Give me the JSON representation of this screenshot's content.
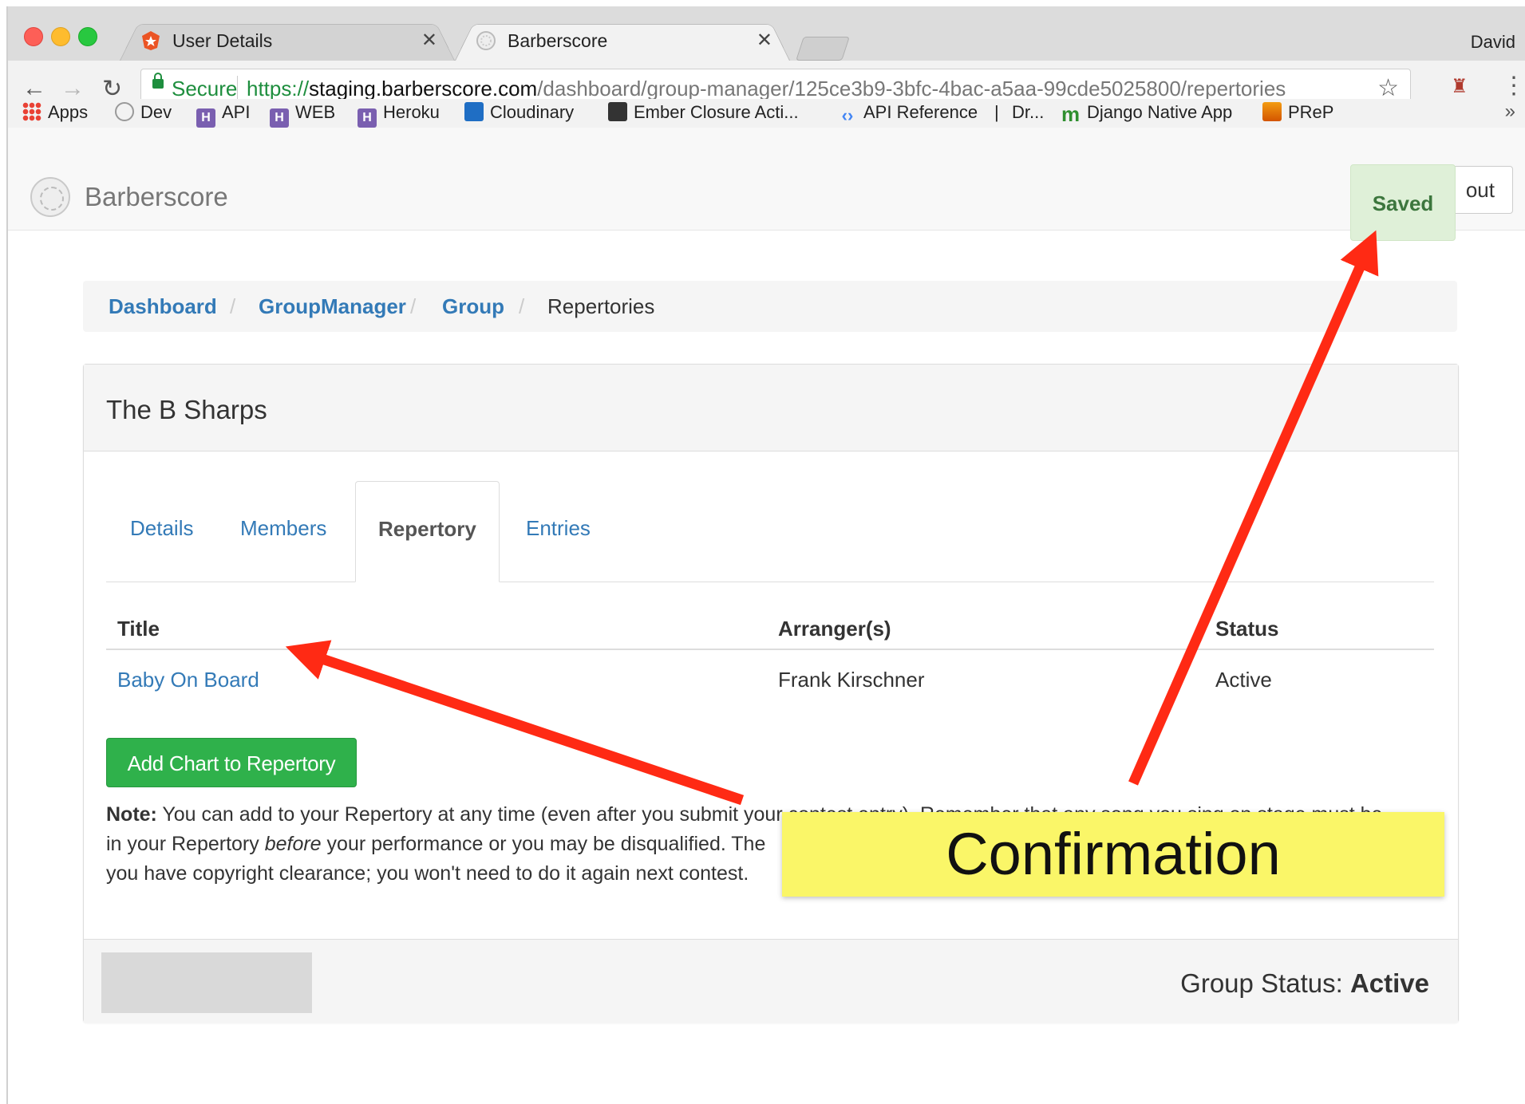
{
  "browser": {
    "tabs": [
      {
        "title": "User Details",
        "active": false
      },
      {
        "title": "Barberscore",
        "active": true
      }
    ],
    "profile_name": "David",
    "address": {
      "secure_label": "Secure",
      "url_scheme": "https://",
      "url_host": "staging.barberscore.com",
      "url_path": "/dashboard/group-manager/125ce3b9-3bfc-4bac-a5aa-99cde5025800/repertories"
    },
    "bookmarks": [
      {
        "label": "Apps",
        "icon": "apps-grid-icon"
      },
      {
        "label": "Dev",
        "icon": "globe-icon"
      },
      {
        "label": "API",
        "icon": "heroku-icon"
      },
      {
        "label": "WEB",
        "icon": "heroku-icon"
      },
      {
        "label": "Heroku",
        "icon": "heroku-icon"
      },
      {
        "label": "Cloudinary",
        "icon": "cloudinary-icon"
      },
      {
        "label": "Ember Closure Acti...",
        "icon": "ember-icon"
      },
      {
        "label": "API Reference",
        "icon": "api-icon"
      },
      {
        "label": "|",
        "icon": ""
      },
      {
        "label": "Dr...",
        "icon": ""
      },
      {
        "label": "Django Native App",
        "icon": "m-icon"
      },
      {
        "label": "PReP",
        "icon": "prep-icon"
      }
    ],
    "bookmarks_overflow": "»"
  },
  "navbar": {
    "brand": "Barberscore",
    "logout_label": "out",
    "toast": "Saved"
  },
  "breadcrumb": {
    "items": [
      {
        "label": "Dashboard",
        "link": true
      },
      {
        "label": "GroupManager",
        "link": true
      },
      {
        "label": "Group",
        "link": true
      },
      {
        "label": "Repertories",
        "link": false
      }
    ],
    "separator": "/"
  },
  "panel": {
    "title": "The B Sharps",
    "tabs": [
      {
        "label": "Details",
        "active": false
      },
      {
        "label": "Members",
        "active": false
      },
      {
        "label": "Repertory",
        "active": true
      },
      {
        "label": "Entries",
        "active": false
      }
    ],
    "table": {
      "columns": [
        "Title",
        "Arranger(s)",
        "Status"
      ],
      "rows": [
        {
          "title": "Baby On Board",
          "arranger": "Frank Kirschner",
          "status": "Active"
        }
      ]
    },
    "add_button": "Add Chart to Repertory",
    "note": {
      "label": "Note:",
      "line1": " You can add to your Repertory at any time (even after you submit your contest entry). Remember that any song you sing on stage must be",
      "line2_pre": "in your Repertory ",
      "line2_em": "before",
      "line2_post": " your performance or you may be disqualified. The",
      "line3": "you have copyright clearance; you won't need to do it again next contest."
    },
    "footer": {
      "status_label": "Group Status:",
      "status_value": "Active"
    }
  },
  "annotation": {
    "callout": "Confirmation",
    "arrow_color": "#ff2a14"
  }
}
